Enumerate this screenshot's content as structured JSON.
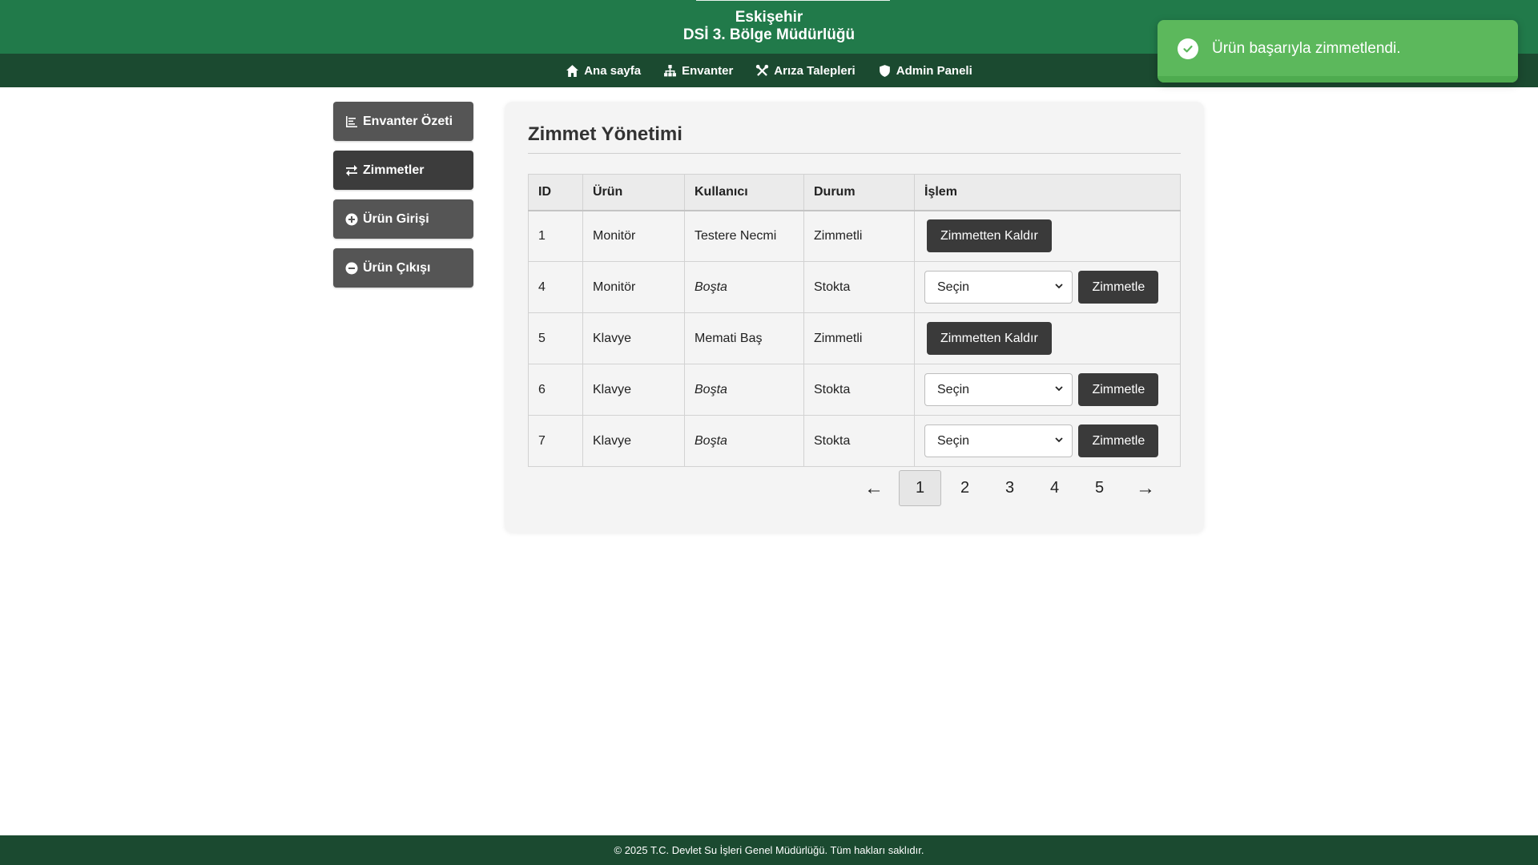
{
  "header": {
    "line1": "Eskişehir",
    "line2": "DSİ 3. Bölge Müdürlüğü"
  },
  "nav": {
    "items": [
      {
        "label": "Ana sayfa",
        "icon": "home-icon"
      },
      {
        "label": "Envanter",
        "icon": "sitemap-icon"
      },
      {
        "label": "Arıza Talepleri",
        "icon": "tools-icon"
      },
      {
        "label": "Admin Paneli",
        "icon": "shield-icon"
      }
    ]
  },
  "toast": {
    "message": "Ürün başarıyla zimmetlendi.",
    "icon": "check-circle-icon",
    "color": "#5cb85c"
  },
  "sidebar": {
    "items": [
      {
        "label": "Envanter Özeti",
        "icon": "chart-icon"
      },
      {
        "label": "Zimmetler",
        "icon": "exchange-icon"
      },
      {
        "label": "Ürün Girişi",
        "icon": "plus-circle-icon"
      },
      {
        "label": "Ürün Çıkışı",
        "icon": "minus-circle-icon"
      }
    ]
  },
  "main": {
    "title": "Zimmet Yönetimi",
    "table": {
      "headers": [
        "ID",
        "Ürün",
        "Kullanıcı",
        "Durum",
        "İşlem"
      ],
      "rows": [
        {
          "id": "1",
          "urun": "Monitör",
          "kullanici": "Testere Necmi",
          "durum": "Zimmetli",
          "action": "Zimmetten Kaldır"
        },
        {
          "id": "4",
          "urun": "Monitör",
          "kullanici": "Boşta",
          "durum": "Stokta",
          "select": "Seçin",
          "action": "Zimmetle"
        },
        {
          "id": "5",
          "urun": "Klavye",
          "kullanici": "Memati Baş",
          "durum": "Zimmetli",
          "action": "Zimmetten Kaldır"
        },
        {
          "id": "6",
          "urun": "Klavye",
          "kullanici": "Boşta",
          "durum": "Stokta",
          "select": "Seçin",
          "action": "Zimmetle"
        },
        {
          "id": "7",
          "urun": "Klavye",
          "kullanici": "Boşta",
          "durum": "Stokta",
          "select": "Seçin",
          "action": "Zimmetle"
        }
      ]
    },
    "pagination": {
      "prev": "←",
      "next": "→",
      "pages": [
        "1",
        "2",
        "3",
        "4",
        "5"
      ],
      "current": "1"
    }
  },
  "footer": {
    "text": "© 2025 T.C. Devlet Su İşleri Genel Müdürlüğü. Tüm hakları saklıdır."
  }
}
